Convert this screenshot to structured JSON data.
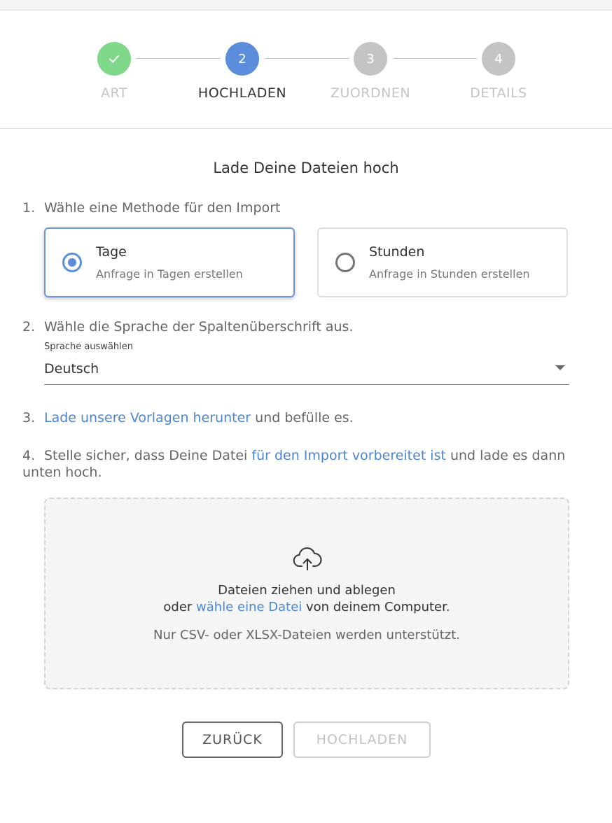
{
  "stepper": {
    "steps": [
      {
        "number": "",
        "label": "ART",
        "state": "completed",
        "icon": "check-icon"
      },
      {
        "number": "2",
        "label": "HOCHLADEN",
        "state": "active"
      },
      {
        "number": "3",
        "label": "ZUORDNEN",
        "state": "inactive"
      },
      {
        "number": "4",
        "label": "DETAILS",
        "state": "inactive"
      }
    ]
  },
  "main": {
    "title": "Lade Deine Dateien hoch",
    "step1": {
      "number": "1.",
      "text": "Wähle eine Methode für den Import"
    },
    "methods": [
      {
        "title": "Tage",
        "subtitle": "Anfrage in Tagen erstellen",
        "selected": true
      },
      {
        "title": "Stunden",
        "subtitle": "Anfrage in Stunden erstellen",
        "selected": false
      }
    ],
    "step2": {
      "number": "2.",
      "text": "Wähle die Sprache der Spaltenüberschrift aus."
    },
    "language_select": {
      "label": "Sprache auswählen",
      "value": "Deutsch"
    },
    "step3": {
      "number": "3.",
      "link": "Lade unsere Vorlagen herunter",
      "text": " und befülle es."
    },
    "step4": {
      "number": "4.",
      "text_before": "Stelle sicher, dass Deine Datei ",
      "link": "für den Import vorbereitet ist",
      "text_after": " und lade es dann unten hoch."
    },
    "dropzone": {
      "line1": "Dateien ziehen und ablegen",
      "line2_before": "oder ",
      "line2_link": "wähle eine Datei",
      "line2_after": " von deinem Computer.",
      "note": "Nur CSV- oder XLSX-Dateien werden unterstützt.",
      "icon": "cloud-upload-icon"
    }
  },
  "buttons": {
    "back": "ZURÜCK",
    "upload": "HOCHLADEN",
    "upload_disabled": true
  },
  "colors": {
    "completed": "#7fd88a",
    "active": "#5b8ddb",
    "inactive": "#c4c4c4",
    "link": "#4a86d8",
    "active_label": "#333333",
    "inactive_label": "#c4c4c4"
  }
}
